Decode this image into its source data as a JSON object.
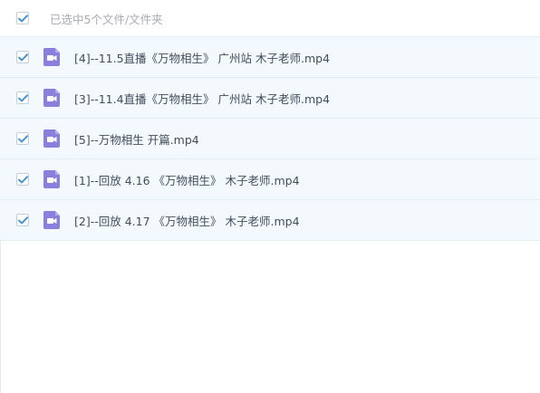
{
  "header": {
    "select_all_checked": true,
    "title": "已选中5个文件/文件夹"
  },
  "files": [
    {
      "name": "[4]--11.5直播《万物相生》 广州站 木子老师.mp4",
      "checked": true,
      "icon": "video-file-icon"
    },
    {
      "name": "[3]--11.4直播《万物相生》 广州站 木子老师.mp4",
      "checked": true,
      "icon": "video-file-icon"
    },
    {
      "name": "[5]--万物相生 开篇.mp4",
      "checked": true,
      "icon": "video-file-icon"
    },
    {
      "name": "[1]--回放 4.16 《万物相生》 木子老师.mp4",
      "checked": true,
      "icon": "video-file-icon"
    },
    {
      "name": "[2]--回放 4.17 《万物相生》 木子老师.mp4",
      "checked": true,
      "icon": "video-file-icon"
    }
  ],
  "colors": {
    "checkbox_check": "#3f8fd2",
    "video_icon": "#8a7fdc",
    "row_background": "#f4f9fd"
  }
}
